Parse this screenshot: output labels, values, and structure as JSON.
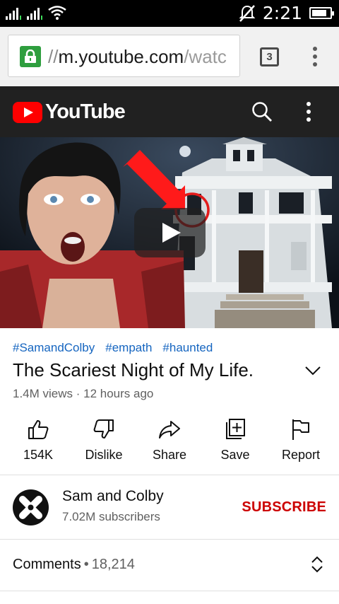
{
  "status_bar": {
    "time": "2:21",
    "battery_level": 0.85
  },
  "browser": {
    "url_scheme": "//",
    "url_host": "m.youtube.com",
    "url_path": "/watc",
    "tab_count": "3"
  },
  "youtube": {
    "logo_text": "YouTube"
  },
  "video": {
    "hashtags": [
      "#SamandColby",
      "#empath",
      "#haunted"
    ],
    "title": "The Scariest Night of My Life.",
    "views": "1.4M views",
    "meta_sep": " · ",
    "age": "12 hours ago"
  },
  "actions": {
    "like": "154K",
    "dislike": "Dislike",
    "share": "Share",
    "save": "Save",
    "report": "Report"
  },
  "channel": {
    "name": "Sam and Colby",
    "subscribers": "7.02M subscribers",
    "subscribe_label": "SUBSCRIBE"
  },
  "comments": {
    "label": "Comments",
    "sep": "•",
    "count": "18,214"
  },
  "colors": {
    "brand_red": "#ff0000",
    "subscribe_red": "#cc0000",
    "link_blue": "#1565c0",
    "lock_green": "#2e9e3e",
    "header_dark": "#212121"
  }
}
